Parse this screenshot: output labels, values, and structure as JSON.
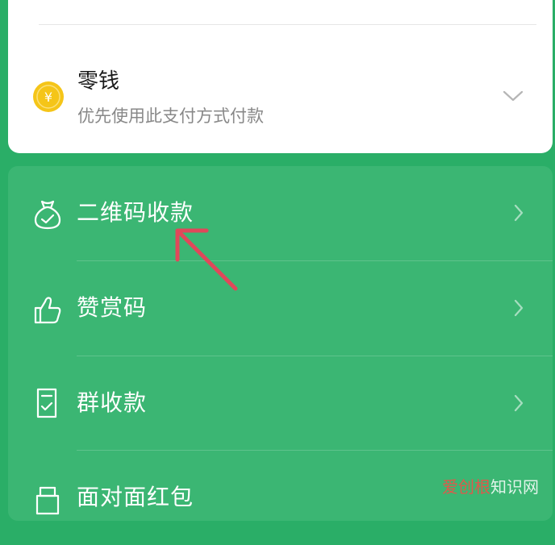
{
  "payment_method": {
    "title": "零钱",
    "subtitle": "优先使用此支付方式付款",
    "icon": "coin-yuan-icon",
    "coin_symbol": "¥",
    "coin_color": "#f5c518"
  },
  "menu": {
    "items": [
      {
        "label": "二维码收款",
        "icon": "money-bag-icon"
      },
      {
        "label": "赞赏码",
        "icon": "thumbs-up-icon"
      },
      {
        "label": "群收款",
        "icon": "group-bill-icon"
      },
      {
        "label": "面对面红包",
        "icon": "red-packet-icon"
      }
    ]
  },
  "annotation": {
    "color": "#e0485a"
  },
  "watermark": {
    "brand": "爱创根",
    "suffix": "知识网"
  },
  "colors": {
    "background": "#2aae67",
    "menu_bg": "#3bb673",
    "card_bg": "#ffffff"
  }
}
